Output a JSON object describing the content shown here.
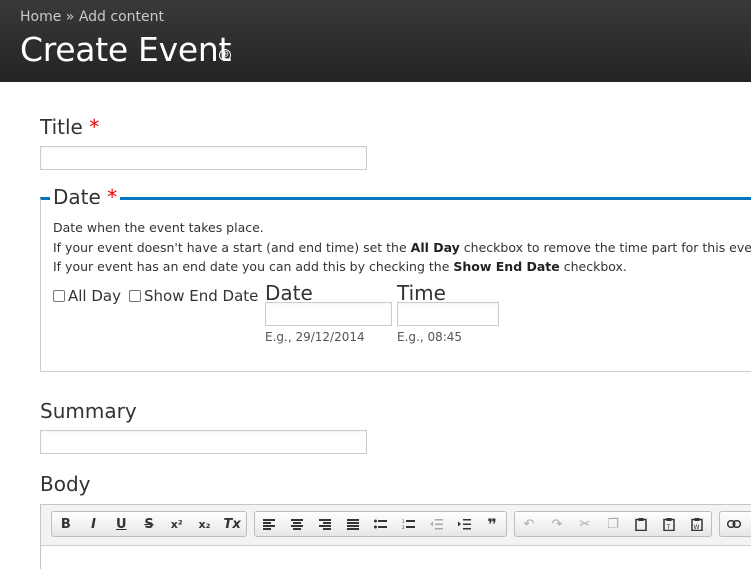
{
  "breadcrumb": {
    "home": "Home",
    "sep": "»",
    "current": "Add content"
  },
  "page_title": "Create Event",
  "shortcut_icon": "⊕",
  "title_field": {
    "label": "Title",
    "required_mark": "*",
    "value": ""
  },
  "date_fieldset": {
    "legend": "Date",
    "required_mark": "*",
    "desc1": "Date when the event takes place.",
    "desc2_pre": "If your event doesn't have a start (and end time) set the ",
    "desc2_bold": "All Day",
    "desc2_post": " checkbox to remove the time part for this event.",
    "desc3_pre": "If your event has an end date you can add this by checking the ",
    "desc3_bold": "Show End Date",
    "desc3_post": " checkbox.",
    "all_day_label": "All Day",
    "show_end_label": "Show End Date",
    "date_label": "Date",
    "date_hint": "E.g., 29/12/2014",
    "time_label": "Time",
    "time_hint": "E.g., 08:45"
  },
  "summary_field": {
    "label": "Summary",
    "value": ""
  },
  "body_field": {
    "label": "Body"
  },
  "toolbar": {
    "group1": [
      "B",
      "I",
      "U",
      "S",
      "x²",
      "x₂",
      "Tx"
    ],
    "group2": [
      "align-left",
      "align-center",
      "align-right",
      "justify",
      "bullet-list",
      "numbered-list",
      "outdent",
      "indent",
      "blockquote"
    ],
    "group3": [
      "undo",
      "redo",
      "cut",
      "copy",
      "paste",
      "paste-text",
      "paste-word"
    ],
    "group4": [
      "link"
    ]
  },
  "colors": {
    "accent": "#0074bd",
    "required": "#e00000",
    "header_bg": "#2b2b2b"
  }
}
